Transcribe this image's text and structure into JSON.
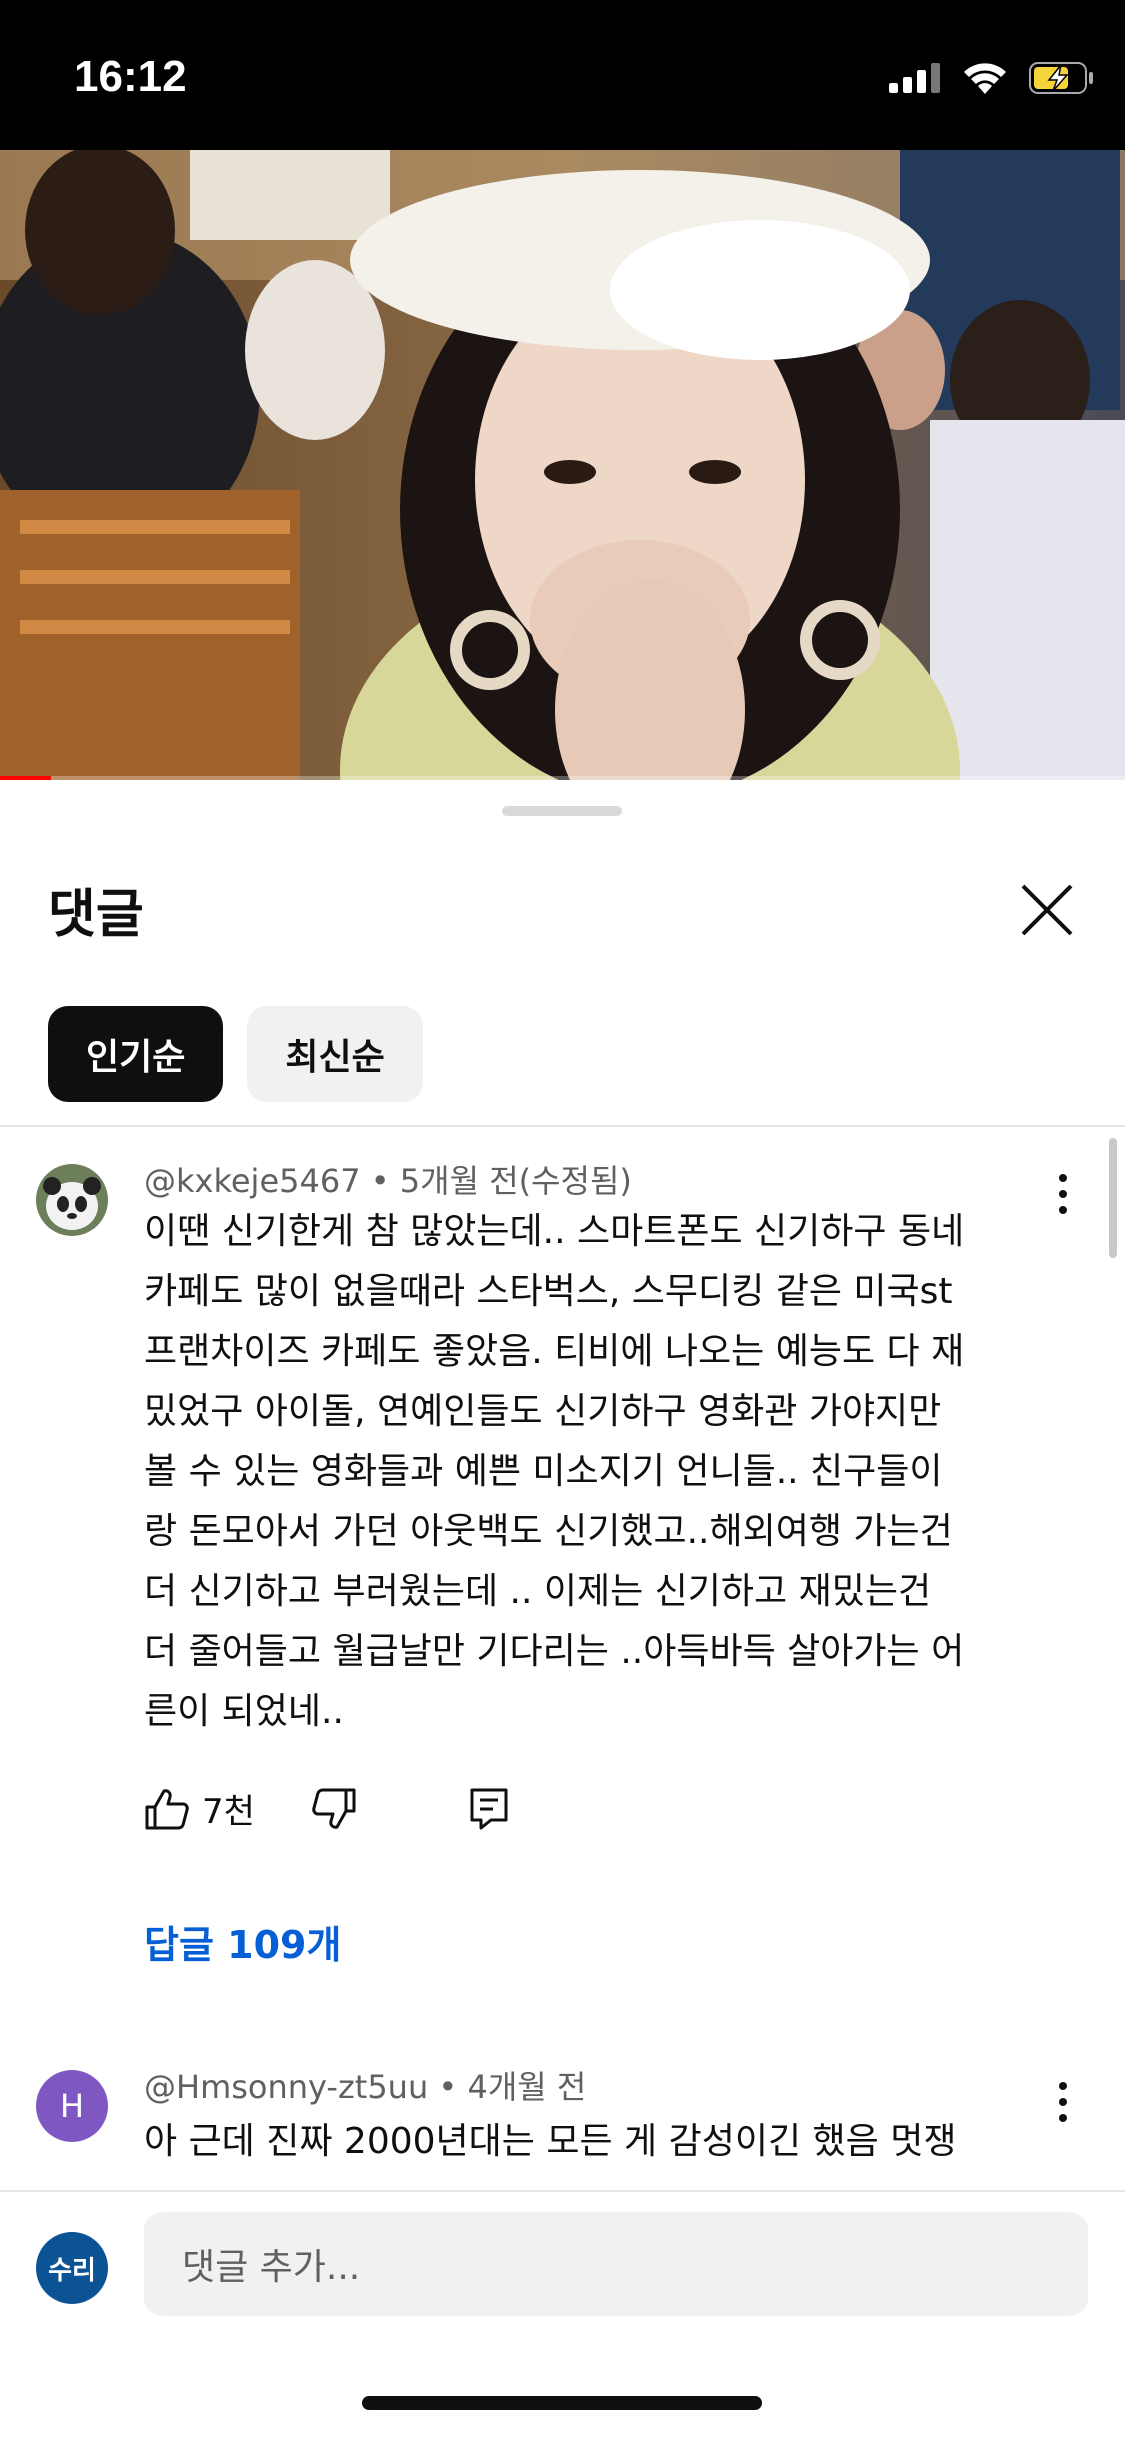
{
  "status_bar": {
    "time": "16:12"
  },
  "video": {
    "progress": 0.045
  },
  "comments_sheet": {
    "title": "댓글",
    "filters": [
      {
        "label": "인기순",
        "selected": true
      },
      {
        "label": "최신순",
        "selected": false
      }
    ],
    "comments": [
      {
        "author": "@kxkeje5467",
        "time": "5개월 전(수정됨)",
        "lines": [
          "이땐 신기한게 참 많았는데.. 스마트폰도 신기하구 동네",
          "카페도 많이 없을때라 스타벅스, 스무디킹 같은 미국st",
          "프랜차이즈 카페도 좋았음. 티비에 나오는 예능도 다 재",
          "밌었구 아이돌, 연예인들도 신기하구 영화관 가야지만",
          "볼 수 있는 영화들과 예쁜 미소지기 언니들.. 친구들이",
          "랑 돈모아서 가던 아웃백도 신기했고..해외여행 가는건",
          "더 신기하고 부러웠는데 .. 이제는 신기하고 재밌는건",
          "더 줄어들고 월급날만 기다리는 ..아득바득 살아가는 어",
          "른이 되었네.."
        ],
        "likes": "7천",
        "replies": "답글 109개"
      },
      {
        "author": "@Hmsonny-zt5uu",
        "time": "4개월 전",
        "avatar_letter": "H",
        "lines": [
          "아 근데 진짜 2000년대는 모든 게 감성이긴 했음 멋쟁"
        ]
      }
    ],
    "add_comment": {
      "avatar_label": "수리",
      "placeholder": "댓글 추가..."
    }
  },
  "colors": {
    "link": "#065fd4",
    "progress": "#ff0000",
    "avatar_h": "#7e57c2",
    "avatar_user": "#0b5394"
  }
}
